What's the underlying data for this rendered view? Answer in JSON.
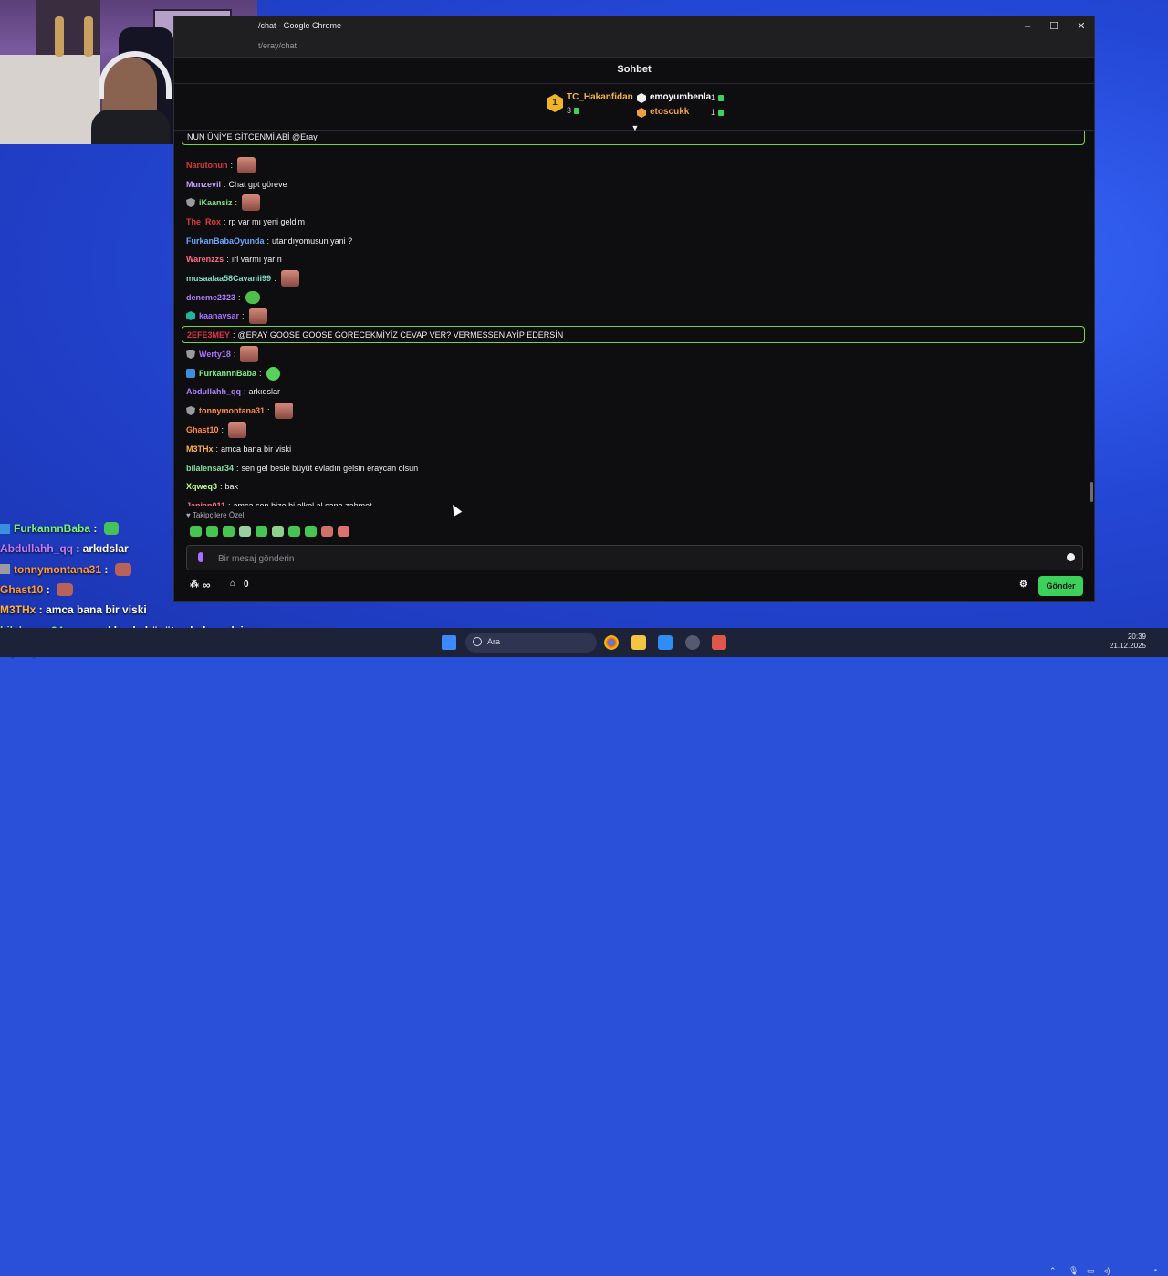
{
  "window": {
    "title": "/chat - Google Chrome",
    "url": "t/eray/chat",
    "controls": {
      "minimize": "–",
      "maximize": "☐",
      "close": "✕"
    }
  },
  "chat": {
    "header": "Sohbet",
    "leaderboard": {
      "first": {
        "rank": "1",
        "name": "TC_Hakanfidan",
        "count": "3"
      },
      "others": [
        {
          "name": "emoyumbenla",
          "count": "1",
          "color": "#ffffff"
        },
        {
          "name": "etoscukk",
          "count": "1",
          "color": "#f0a040"
        }
      ]
    },
    "messages": [
      {
        "user": "",
        "text": "NUN ÜNİYE GİTCENMİ ABİ @Eray",
        "color": "#efeff1",
        "highlight": true,
        "emote": ""
      },
      {
        "user": "Narutonun",
        "text": "",
        "color": "#d63a3a",
        "emote": "face"
      },
      {
        "user": "Munzevil",
        "text": "Chat gpt göreve",
        "color": "#c79dff",
        "emote": ""
      },
      {
        "user": "iKaansiz",
        "text": "",
        "color": "#7ee07e",
        "badge": "shield",
        "emote": "face"
      },
      {
        "user": "The_Rox",
        "text": "rp var mı yeni geldim",
        "color": "#e03c3c",
        "emote": ""
      },
      {
        "user": "FurkanBabaOyunda",
        "text": "utandıyomusun yani ?",
        "color": "#6aa7ff",
        "emote": ""
      },
      {
        "user": "Warenzzs",
        "text": "ırl varmı yarın",
        "color": "#ff6b8a",
        "emote": ""
      },
      {
        "user": "musaalaa58Cavanii99",
        "text": "",
        "color": "#7ee0c8",
        "emote": "face"
      },
      {
        "user": "deneme2323",
        "text": "",
        "color": "#b07dff",
        "emote": "frog"
      },
      {
        "user": "kaanavsar",
        "text": "",
        "color": "#a970ff",
        "badge": "teal",
        "emote": "face"
      },
      {
        "user": "2EFE3MEY",
        "text": "@ERAY GOOSE GOOSE GORECEKMİYİZ CEVAP VER? VERMESSEN AYİP EDERSİN",
        "color": "#e0334a",
        "highlight": true,
        "emote": ""
      },
      {
        "user": "Werty18",
        "text": "",
        "color": "#a970ff",
        "badge": "shield",
        "emote": "face"
      },
      {
        "user": "FurkannnBaba",
        "text": "",
        "color": "#7cf07c",
        "badge": "vip",
        "emote": "green"
      },
      {
        "user": "Abdullahh_qq",
        "text": "arkıdslar",
        "color": "#b07dff",
        "emote": ""
      },
      {
        "user": "tonnymontana31",
        "text": "",
        "color": "#ff8c3c",
        "badge": "shield",
        "emote": "face"
      },
      {
        "user": "Ghast10",
        "text": "",
        "color": "#ff8c3c",
        "emote": "face"
      },
      {
        "user": "M3THx",
        "text": "amca bana bir viski",
        "color": "#ffb347",
        "emote": ""
      },
      {
        "user": "bilalensar34",
        "text": "sen gel besle büyüt evladın gelsin eraycan olsun",
        "color": "#7ee0a0",
        "emote": ""
      },
      {
        "user": "Xqweq3",
        "text": "bak",
        "color": "#c0ff8a",
        "emote": ""
      },
      {
        "user": "Janjan011",
        "text": "amca sen bize bi alkol al sana zahmet",
        "color": "#ff6b8a",
        "emote": ""
      }
    ],
    "followers_label": "Takipçilere Özel",
    "input_placeholder": "Bir mesaj gönderin",
    "points": "∞",
    "store_count": "0",
    "send_label": "Gönder"
  },
  "overlay": [
    {
      "user": "FurkannnBaba",
      "text": "",
      "color": "#7cf07c",
      "emote": "green"
    },
    {
      "user": "Abdullahh_qq",
      "text": "arkıdslar",
      "color": "#c57dff",
      "emote": ""
    },
    {
      "user": "tonnymontana31",
      "text": "",
      "color": "#ff9a3c",
      "emote": "face"
    },
    {
      "user": "Ghast10",
      "text": "",
      "color": "#ff9a3c",
      "emote": "face"
    },
    {
      "user": "M3THx",
      "text": "amca bana bir viski",
      "color": "#ffb347",
      "emote": ""
    },
    {
      "user": "bilalensar34",
      "text": "sen gel besle büyüt evladın gelsin er",
      "color": "#7ee0a0",
      "emote": ""
    },
    {
      "user": "Xqweq3",
      "text": "bak",
      "color": "#c0ff8a",
      "emote": ""
    }
  ],
  "taskbar": {
    "search_label": "Ara",
    "time": "20:39",
    "date": "21.12.2025"
  }
}
